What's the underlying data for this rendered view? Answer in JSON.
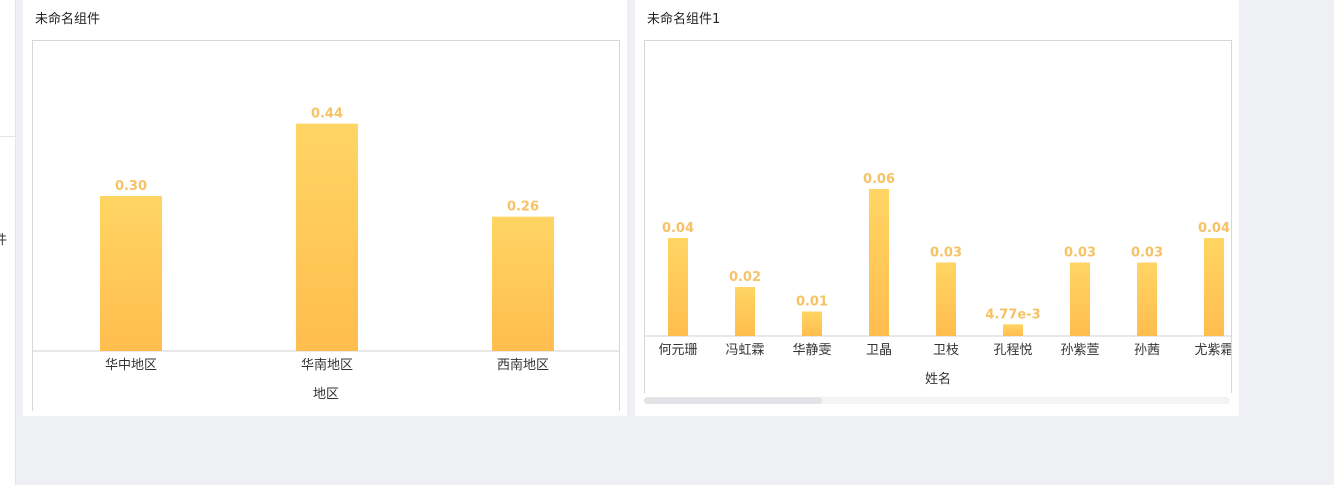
{
  "sidebar": {
    "fragment": "件"
  },
  "panels": [
    {
      "title": "未命名组件"
    },
    {
      "title": "未命名组件1"
    }
  ],
  "colors": {
    "bar_top": "#ffd564",
    "bar_bottom": "#ffbd4e",
    "label": "#f6c265"
  },
  "chart_data": [
    {
      "type": "bar",
      "xlabel": "地区",
      "categories": [
        "华中地区",
        "华南地区",
        "西南地区"
      ],
      "values": [
        0.3,
        0.44,
        0.26
      ],
      "value_labels": [
        "0.30",
        "0.44",
        "0.26"
      ]
    },
    {
      "type": "bar",
      "xlabel": "姓名",
      "categories": [
        "何元珊",
        "冯虹霖",
        "华静雯",
        "卫晶",
        "卫枝",
        "孔程悦",
        "孙紫萱",
        "孙茜",
        "尤紫霜"
      ],
      "values": [
        0.04,
        0.02,
        0.01,
        0.06,
        0.03,
        0.00477,
        0.03,
        0.03,
        0.04
      ],
      "value_labels": [
        "0.04",
        "0.02",
        "0.01",
        "0.06",
        "0.03",
        "4.77e-3",
        "0.03",
        "0.03",
        "0.04"
      ]
    }
  ]
}
